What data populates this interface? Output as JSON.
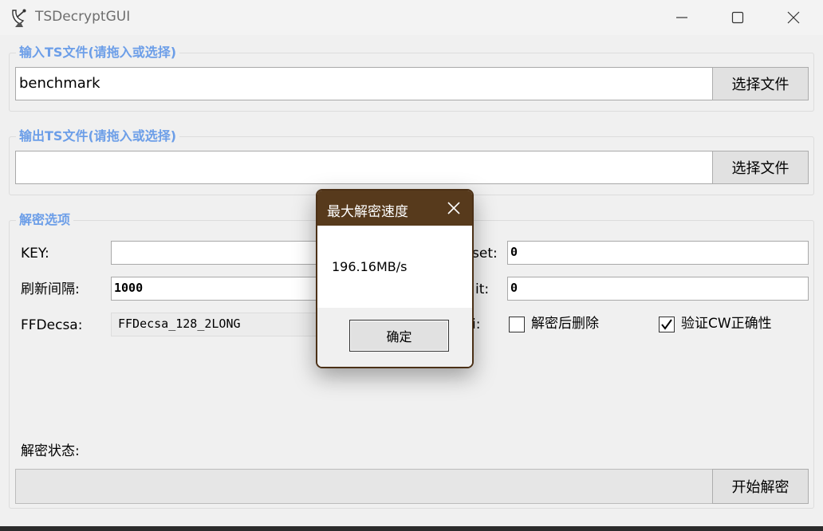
{
  "window": {
    "title": "TSDecryptGUI",
    "icon": "satellite-dish-icon"
  },
  "input_group": {
    "title": "输入TS文件(请拖入或选择)",
    "path_value": "benchmark",
    "button_label": "选择文件"
  },
  "output_group": {
    "title": "输出TS文件(请拖入或选择)",
    "path_value": "",
    "button_label": "选择文件"
  },
  "options": {
    "title": "解密选项",
    "key_label": "KEY:",
    "key_value": "",
    "refresh_label": "刷新间隔:",
    "refresh_value": "1000",
    "ffdecsa_label": "FFDecsa:",
    "ffdecsa_value": "FFDecsa_128_2LONG",
    "offset_label": "set:",
    "offset_value": "0",
    "limit_label": "it:",
    "limit_value": "0",
    "misc_label": "i:",
    "delete_after_label": "解密后删除",
    "delete_after_checked": false,
    "verify_cw_label": "验证CW正确性",
    "verify_cw_checked": true
  },
  "status": {
    "label": "解密状态:",
    "progress": 0,
    "start_button_label": "开始解密"
  },
  "dialog": {
    "title": "最大解密速度",
    "message": "196.16MB/s",
    "ok_label": "确定"
  },
  "colors": {
    "group_title": "#6c9ee8",
    "dialog_title_bg": "#573a1c",
    "window_bg": "#f0f0f0"
  }
}
